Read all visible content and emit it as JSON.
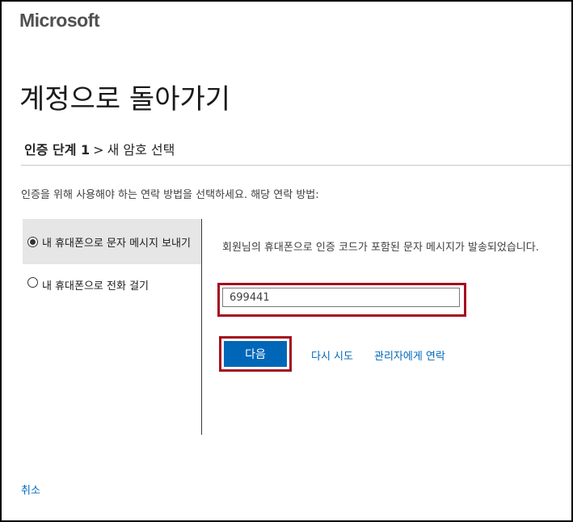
{
  "brand": {
    "logo_text": "Microsoft"
  },
  "page": {
    "title": "계정으로 돌아가기"
  },
  "breadcrumb": {
    "step": "인증 단계 1",
    "separator": ">",
    "next": "새 암호 선택"
  },
  "instructions": "인증을 위해 사용해야 하는 연락 방법을 선택하세요. 해당 연락 방법:",
  "methods": [
    {
      "label": "내 휴대폰으로 문자 메시지 보내기",
      "selected": true
    },
    {
      "label": "내 휴대폰으로 전화 걸기",
      "selected": false
    }
  ],
  "verification": {
    "message": "회원님의 휴대폰으로 인증 코드가 포함된 문자 메시지가 발송되었습니다.",
    "code_value": "699441"
  },
  "actions": {
    "next_label": "다음",
    "retry_label": "다시 시도",
    "contact_admin_label": "관리자에게 연락",
    "cancel_label": "취소"
  },
  "colors": {
    "accent": "#0067b8",
    "highlight_border": "#a50d1e"
  }
}
